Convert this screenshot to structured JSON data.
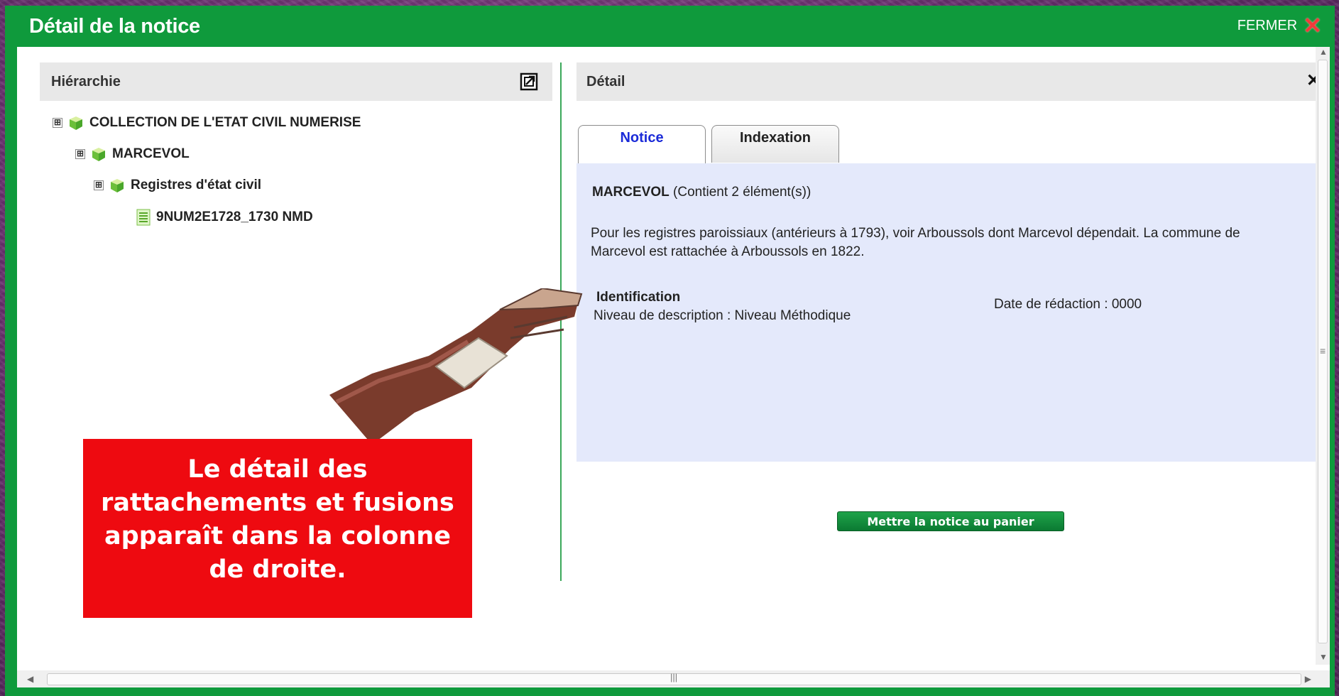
{
  "dialog": {
    "title": "Détail de la notice",
    "close_label": "FERMER",
    "close_symbol": "✕"
  },
  "hierarchy": {
    "title": "Hiérarchie",
    "popout_icon": "popout-icon",
    "items": [
      {
        "label": "COLLECTION DE L'ETAT CIVIL NUMERISE",
        "icon": "cube-icon",
        "expander": "⊞"
      },
      {
        "label": "MARCEVOL",
        "icon": "cube-icon",
        "expander": "⊞"
      },
      {
        "label": "Registres d'état civil",
        "icon": "cube-icon",
        "expander": "⊞"
      },
      {
        "label": "9NUM2E1728_1730 NMD",
        "icon": "document-icon"
      }
    ]
  },
  "detail": {
    "title": "Détail",
    "close_symbol": "✕",
    "tabs": [
      {
        "label": "Notice",
        "active": true
      },
      {
        "label": "Indexation",
        "active": false
      }
    ],
    "notice": {
      "name": "MARCEVOL",
      "count": "(Contient 2 élément(s))",
      "description": "Pour les registres paroissiaux (antérieurs à 1793), voir Arboussols dont Marcevol dépendait. La commune de Marcevol est rattachée à Arboussols en 1822.",
      "identification_heading": "Identification",
      "level": "Niveau de description : Niveau Méthodique",
      "date": "Date de rédaction : 0000"
    },
    "basket_button": "Mettre la notice au panier"
  },
  "annotation": {
    "text": "Le détail des rattachements et fusions apparaît dans la colonne de droite."
  },
  "colors": {
    "frame_green": "#0f9a3c",
    "annotation_red": "#ee0a10",
    "active_tab_blue": "#1b2bd8",
    "detail_bg": "#e4e9fb"
  }
}
